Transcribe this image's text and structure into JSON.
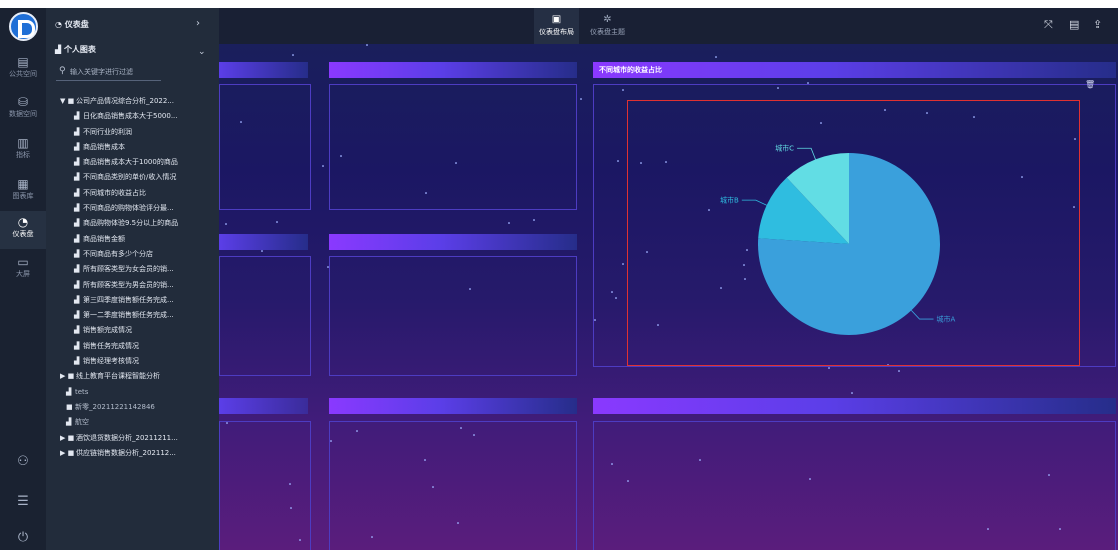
{
  "rail": {
    "items": [
      {
        "icon": "document-icon",
        "label": "公共空间"
      },
      {
        "icon": "database-icon",
        "label": "数据空间"
      },
      {
        "icon": "bar-chart-icon",
        "label": "指标"
      },
      {
        "icon": "chart-library-icon",
        "label": "图表库"
      },
      {
        "icon": "gauge-icon",
        "label": "仪表盘"
      },
      {
        "icon": "monitor-icon",
        "label": "大屏"
      }
    ],
    "active_index": 4
  },
  "tree": {
    "header": "仪表盘",
    "subheader": "个人图表",
    "search_placeholder": "输入关键字进行过滤",
    "items": [
      {
        "label": "公司产品情况综合分析_2022...",
        "type": "folder-open",
        "level": 0
      },
      {
        "label": "日化商品销售成本大于5000...",
        "type": "chart",
        "level": 1
      },
      {
        "label": "不同行业的利润",
        "type": "chart",
        "level": 1
      },
      {
        "label": "商品销售成本",
        "type": "chart",
        "level": 1
      },
      {
        "label": "商品销售成本大于1000的商品",
        "type": "chart",
        "level": 1
      },
      {
        "label": "不同商品类别的单价/收入情况",
        "type": "chart",
        "level": 1
      },
      {
        "label": "不同城市的收益占比",
        "type": "chart",
        "level": 1
      },
      {
        "label": "不同商品的购物体验评分最...",
        "type": "chart",
        "level": 1
      },
      {
        "label": "商品购物体验9.5分以上的商品",
        "type": "chart",
        "level": 1
      },
      {
        "label": "商品销售金额",
        "type": "chart",
        "level": 1
      },
      {
        "label": "不同商品有多少个分店",
        "type": "chart",
        "level": 1
      },
      {
        "label": "所有顾客类型为女会员的销...",
        "type": "chart",
        "level": 1
      },
      {
        "label": "所有顾客类型为男会员的销...",
        "type": "chart",
        "level": 1
      },
      {
        "label": "第三四季度销售额任务完成...",
        "type": "chart",
        "level": 1
      },
      {
        "label": "第一二季度销售额任务完成...",
        "type": "chart",
        "level": 1
      },
      {
        "label": "销售额完成情况",
        "type": "chart",
        "level": 1
      },
      {
        "label": "销售任务完成情况",
        "type": "chart",
        "level": 1
      },
      {
        "label": "销售经理考核情况",
        "type": "chart",
        "level": 1
      },
      {
        "label": "线上教育平台课程智能分析",
        "type": "folder",
        "level": 0
      },
      {
        "label": "tets",
        "type": "chart",
        "level": 0,
        "muted": true
      },
      {
        "label": "新零_20211221142846",
        "type": "folder-plain",
        "level": 0,
        "muted": true
      },
      {
        "label": "航空",
        "type": "chart",
        "level": 0,
        "muted": true
      },
      {
        "label": "酒饮退货数据分析_20211211...",
        "type": "folder",
        "level": 0
      },
      {
        "label": "供应链销售数据分析_202112...",
        "type": "folder",
        "level": 0
      }
    ]
  },
  "topbar": {
    "layout_label": "仪表盘布局",
    "theme_label": "仪表盘主题",
    "right_icons": [
      "fullscreen-icon",
      "save-icon",
      "share-icon"
    ]
  },
  "widget": {
    "title": "不同城市的收益占比",
    "delete_icon": "trash-icon"
  },
  "chart_data": {
    "type": "pie",
    "title": "不同城市的收益占比",
    "slices": [
      {
        "name": "城市A",
        "value": 76,
        "color": "#3aa0dc"
      },
      {
        "name": "城市B",
        "value": 12,
        "color": "#2fbde0"
      },
      {
        "name": "城市C",
        "value": 12,
        "color": "#62dde4"
      }
    ]
  },
  "colors": {
    "accent": "#8a39ff",
    "selection": "#e03131",
    "panel_border": "#4d3cc2"
  }
}
